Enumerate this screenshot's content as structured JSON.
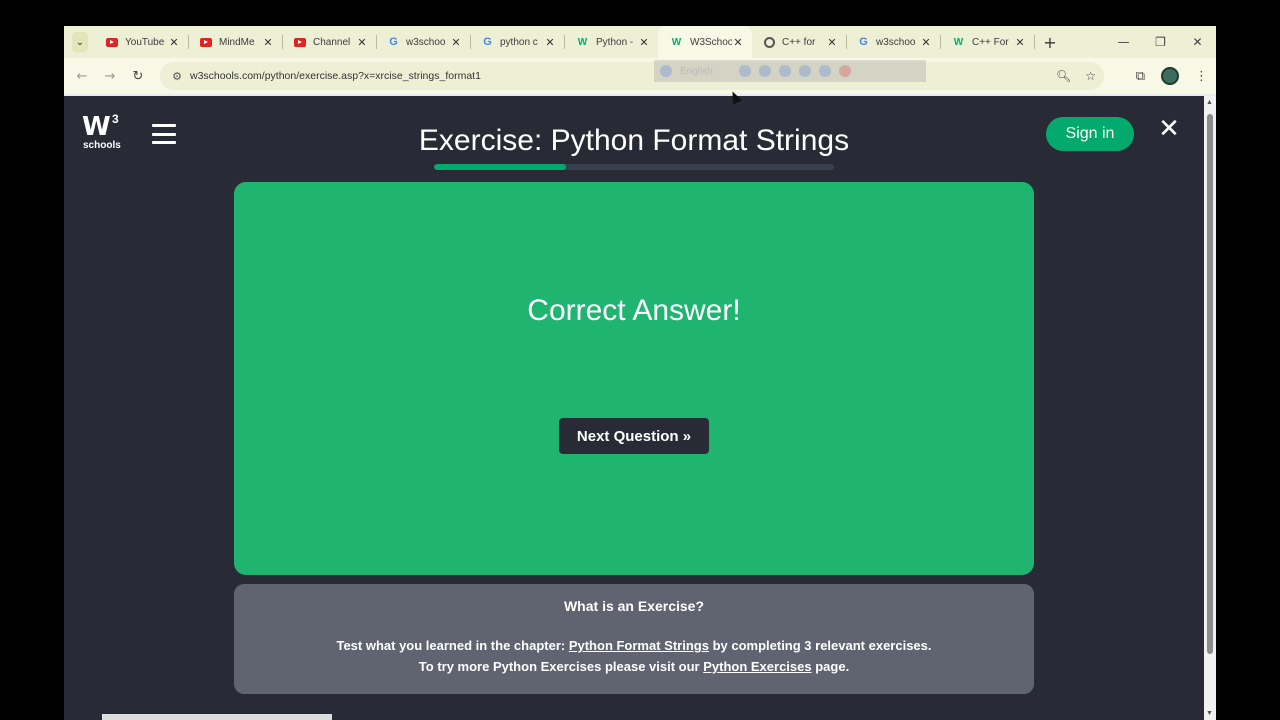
{
  "browser": {
    "tabs": [
      {
        "label": "YouTube",
        "icon": "youtube-icon"
      },
      {
        "label": "MindMe",
        "icon": "youtube-icon"
      },
      {
        "label": "Channel",
        "icon": "youtube-icon"
      },
      {
        "label": "w3schoo",
        "icon": "google-icon"
      },
      {
        "label": "python c",
        "icon": "google-icon"
      },
      {
        "label": "Python -",
        "icon": "w3schools-icon"
      },
      {
        "label": "W3Schoo",
        "icon": "w3schools-icon",
        "active": true
      },
      {
        "label": "C++ for",
        "icon": "chatgpt-icon"
      },
      {
        "label": "w3schoo",
        "icon": "google-icon"
      },
      {
        "label": "C++ For",
        "icon": "w3schools-icon"
      }
    ],
    "url": "w3schools.com/python/exercise.asp?x=xrcise_strings_format1",
    "translate_language": "English"
  },
  "site": {
    "logo_mark": "W",
    "logo_sup": "3",
    "logo_text": "schools",
    "signin_label": "Sign in"
  },
  "exercise": {
    "title": "Exercise: Python Format Strings",
    "progress": 0.33,
    "result_message": "Correct Answer!",
    "next_button": "Next Question »"
  },
  "info": {
    "heading": "What is an Exercise?",
    "line1_pre": "Test what you learned in the chapter: ",
    "line1_link": "Python Format Strings",
    "line1_post": " by completing 3 relevant exercises.",
    "line2_pre": "To try more Python Exercises please visit our ",
    "line2_link": "Python Exercises",
    "line2_post": " page."
  },
  "colors": {
    "accent": "#04aa6d",
    "card": "#1fb571",
    "page_bg": "#282a35"
  }
}
